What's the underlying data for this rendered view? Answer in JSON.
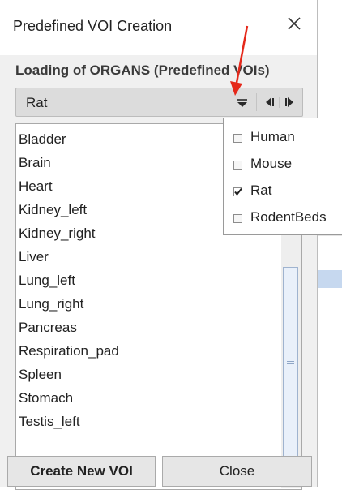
{
  "window": {
    "title": "Predefined VOI Creation"
  },
  "section": {
    "title": "Loading of ORGANS (Predefined VOIs)"
  },
  "combo": {
    "value": "Rat"
  },
  "organs": [
    "Bladder",
    "Brain",
    "Heart",
    "Kidney_left",
    "Kidney_right",
    "Liver",
    "Lung_left",
    "Lung_right",
    "Pancreas",
    "Respiration_pad",
    "Spleen",
    "Stomach",
    "Testis_left"
  ],
  "popup": {
    "options": [
      {
        "label": "Human",
        "checked": false
      },
      {
        "label": "Mouse",
        "checked": false
      },
      {
        "label": "Rat",
        "checked": true
      },
      {
        "label": "RodentBeds",
        "checked": false
      }
    ]
  },
  "buttons": {
    "create": "Create New VOI",
    "close": "Close"
  },
  "icons": [
    "close-icon",
    "dropdown-arrow-icon",
    "previous-arrow-icon",
    "next-arrow-icon",
    "scroll-down-arrow-icon",
    "checkmark-icon",
    "annotation-arrow-icon"
  ],
  "colors": {
    "annotation_arrow": "#e5281a",
    "highlight_band": "#c6d8ef"
  }
}
